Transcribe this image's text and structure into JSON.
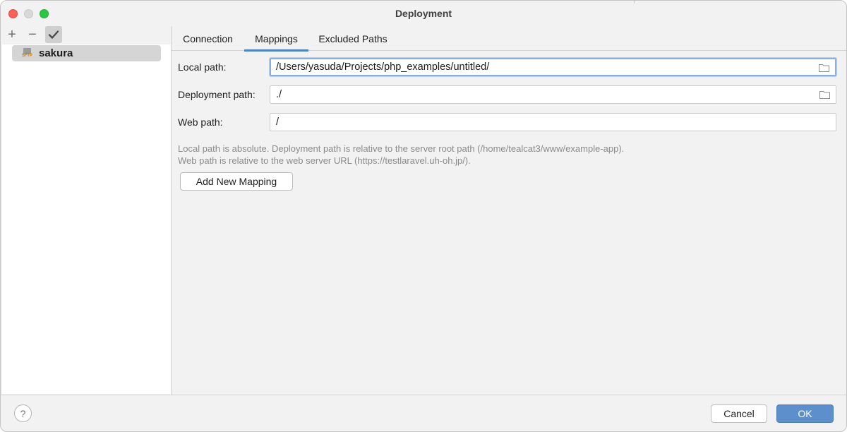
{
  "window": {
    "title": "Deployment"
  },
  "toolbar": {
    "add_symbol": "+",
    "remove_symbol": "−",
    "check_symbol": "✔"
  },
  "servers": [
    {
      "name": "sakura",
      "icon_label": "SFTP",
      "icon": "sftp-icon",
      "selected": true
    }
  ],
  "tabs": [
    {
      "label": "Connection",
      "active": false
    },
    {
      "label": "Mappings",
      "active": true
    },
    {
      "label": "Excluded Paths",
      "active": false
    }
  ],
  "mapping": {
    "local_label": "Local path:",
    "local_value": "/Users/yasuda/Projects/php_examples/untitled/",
    "deployment_label": "Deployment path:",
    "deployment_value": "./",
    "web_label": "Web path:",
    "web_value": "/"
  },
  "hint": {
    "line1": "Local path is absolute. Deployment path is relative to the server root path (/home/tealcat3/www/example-app).",
    "line2": "Web path is relative to the web server URL (https://testlaravel.uh-oh.jp/)."
  },
  "buttons": {
    "add_mapping": "Add New Mapping",
    "cancel": "Cancel",
    "ok": "OK",
    "help": "?"
  },
  "colors": {
    "accent": "#4a83c7",
    "primary_button": "#5c8fcc",
    "close": "#fe5f57",
    "maximize": "#2ac840"
  }
}
